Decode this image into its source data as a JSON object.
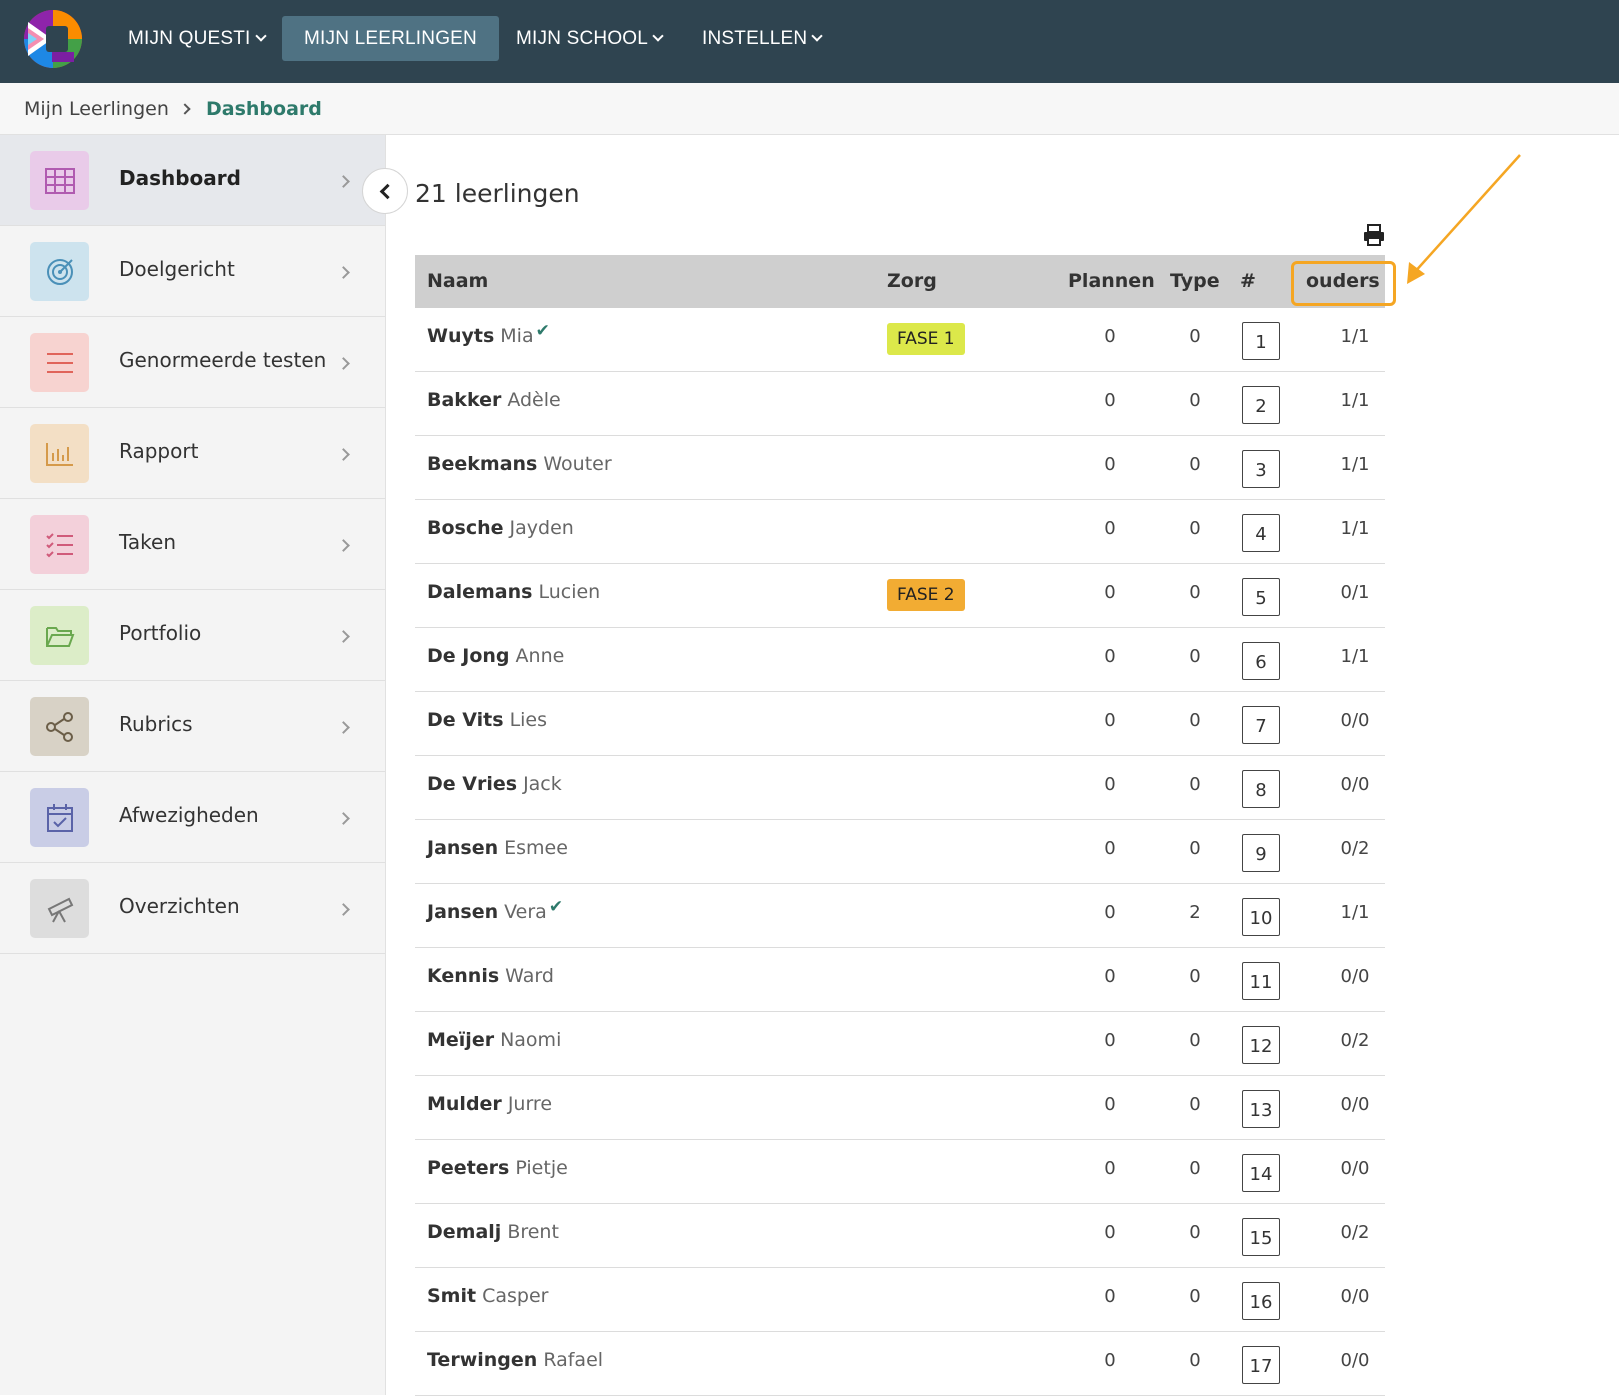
{
  "nav": {
    "items": [
      {
        "label": "MIJN QUESTI",
        "dropdown": true,
        "active": false
      },
      {
        "label": "MIJN LEERLINGEN",
        "dropdown": false,
        "active": true
      },
      {
        "label": "MIJN SCHOOL",
        "dropdown": true,
        "active": false
      },
      {
        "label": "INSTELLEN",
        "dropdown": true,
        "active": false
      }
    ]
  },
  "breadcrumb": {
    "parent": "Mijn Leerlingen",
    "current": "Dashboard"
  },
  "sidebar": {
    "items": [
      {
        "label": "Dashboard",
        "icon": "grid-icon",
        "color": "#e9cbe9",
        "active": true
      },
      {
        "label": "Doelgericht",
        "icon": "target-icon",
        "color": "#cde3ee"
      },
      {
        "label": "Genormeerde testen",
        "icon": "lines-icon",
        "color": "#f7d3d0"
      },
      {
        "label": "Rapport",
        "icon": "bar-chart-icon",
        "color": "#f3dfc5"
      },
      {
        "label": "Taken",
        "icon": "checklist-icon",
        "color": "#f3d0da"
      },
      {
        "label": "Portfolio",
        "icon": "folder-icon",
        "color": "#dcedc8"
      },
      {
        "label": "Rubrics",
        "icon": "share-icon",
        "color": "#d8d2c6"
      },
      {
        "label": "Afwezigheden",
        "icon": "calendar-check-icon",
        "color": "#c9cde6"
      },
      {
        "label": "Overzichten",
        "icon": "telescope-icon",
        "color": "#dddddd"
      }
    ]
  },
  "main": {
    "title": "21 leerlingen",
    "columns": {
      "naam": "Naam",
      "zorg": "Zorg",
      "plannen": "Plannen",
      "type": "Type",
      "num": "#",
      "ouders": "ouders"
    },
    "rows": [
      {
        "last": "Wuyts",
        "first": "Mia",
        "check": "✔",
        "zorg": "FASE 1",
        "zorg_color": "#dce84a",
        "plannen": "0",
        "type": "0",
        "num": "1",
        "ouders": "1/1"
      },
      {
        "last": "Bakker",
        "first": "Adèle",
        "check": "",
        "zorg": "",
        "plannen": "0",
        "type": "0",
        "num": "2",
        "ouders": "1/1"
      },
      {
        "last": "Beekmans",
        "first": "Wouter",
        "check": "",
        "zorg": "",
        "plannen": "0",
        "type": "0",
        "num": "3",
        "ouders": "1/1"
      },
      {
        "last": "Bosche",
        "first": "Jayden",
        "check": "",
        "zorg": "",
        "plannen": "0",
        "type": "0",
        "num": "4",
        "ouders": "1/1"
      },
      {
        "last": "Dalemans",
        "first": "Lucien",
        "check": "",
        "zorg": "FASE 2",
        "zorg_color": "#f2ac33",
        "plannen": "0",
        "type": "0",
        "num": "5",
        "ouders": "0/1"
      },
      {
        "last": "De Jong",
        "first": "Anne",
        "check": "",
        "zorg": "",
        "plannen": "0",
        "type": "0",
        "num": "6",
        "ouders": "1/1"
      },
      {
        "last": "De Vits",
        "first": "Lies",
        "check": "",
        "zorg": "",
        "plannen": "0",
        "type": "0",
        "num": "7",
        "ouders": "0/0"
      },
      {
        "last": "De Vries",
        "first": "Jack",
        "check": "",
        "zorg": "",
        "plannen": "0",
        "type": "0",
        "num": "8",
        "ouders": "0/0"
      },
      {
        "last": "Jansen",
        "first": "Esmee",
        "check": "",
        "zorg": "",
        "plannen": "0",
        "type": "0",
        "num": "9",
        "ouders": "0/2"
      },
      {
        "last": "Jansen",
        "first": "Vera",
        "check": "✔",
        "zorg": "",
        "plannen": "0",
        "type": "2",
        "num": "10",
        "ouders": "1/1"
      },
      {
        "last": "Kennis",
        "first": "Ward",
        "check": "",
        "zorg": "",
        "plannen": "0",
        "type": "0",
        "num": "11",
        "ouders": "0/0"
      },
      {
        "last": "Meïjer",
        "first": "Naomi",
        "check": "",
        "zorg": "",
        "plannen": "0",
        "type": "0",
        "num": "12",
        "ouders": "0/2"
      },
      {
        "last": "Mulder",
        "first": "Jurre",
        "check": "",
        "zorg": "",
        "plannen": "0",
        "type": "0",
        "num": "13",
        "ouders": "0/0"
      },
      {
        "last": "Peeters",
        "first": "Pietje",
        "check": "",
        "zorg": "",
        "plannen": "0",
        "type": "0",
        "num": "14",
        "ouders": "0/0"
      },
      {
        "last": "Demalj",
        "first": "Brent",
        "check": "",
        "zorg": "",
        "plannen": "0",
        "type": "0",
        "num": "15",
        "ouders": "0/2"
      },
      {
        "last": "Smit",
        "first": "Casper",
        "check": "",
        "zorg": "",
        "plannen": "0",
        "type": "0",
        "num": "16",
        "ouders": "0/0"
      },
      {
        "last": "Terwingen",
        "first": "Rafael",
        "check": "",
        "zorg": "",
        "plannen": "0",
        "type": "0",
        "num": "17",
        "ouders": "0/0"
      }
    ]
  },
  "colors": {
    "topbar": "#2f4450",
    "nav_active": "#4f7283",
    "accent": "#2e7a6b",
    "highlight": "#f5a623"
  }
}
